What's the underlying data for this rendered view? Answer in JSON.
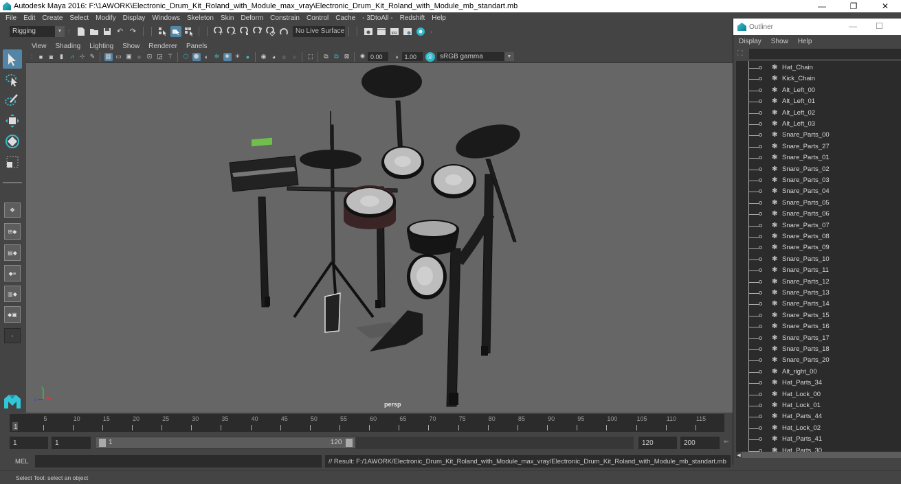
{
  "window": {
    "title": "Autodesk Maya 2016: F:\\1AWORK\\Electronic_Drum_Kit_Roland_with_Module_max_vray\\Electronic_Drum_Kit_Roland_with_Module_mb_standart.mb",
    "minimize": "—",
    "restore": "❐",
    "close": "✕"
  },
  "menubar": [
    "File",
    "Edit",
    "Create",
    "Select",
    "Modify",
    "Display",
    "Windows",
    "Skeleton",
    "Skin",
    "Deform",
    "Constrain",
    "Control",
    "Cache",
    "- 3DtoAll -",
    "Redshift",
    "Help"
  ],
  "statusline": {
    "menuset": "Rigging",
    "live_surface": "No Live Surface",
    "icons": [
      "new-scene-icon",
      "open-scene-icon",
      "save-scene-icon",
      "undo-icon",
      "redo-icon",
      "select-hierarchy-icon",
      "select-object-icon",
      "select-component-icon",
      "snap-grid-icon",
      "snap-curve-icon",
      "snap-point-icon",
      "snap-view-plane-icon",
      "snap-live-icon",
      "make-live-icon",
      "render-view-icon",
      "render-current-icon",
      "ipr-render-icon",
      "render-settings-icon",
      "hypershade-icon"
    ]
  },
  "panel": {
    "menus": [
      "View",
      "Shading",
      "Lighting",
      "Show",
      "Renderer",
      "Panels"
    ],
    "exposure": "0.00",
    "gamma": "1.00",
    "color_space": "sRGB gamma",
    "camera_label": "persp"
  },
  "timeline": {
    "current_frame": "1",
    "ticks": [
      5,
      10,
      15,
      20,
      25,
      30,
      35,
      40,
      45,
      50,
      55,
      60,
      65,
      70,
      75,
      80,
      85,
      90,
      95,
      100,
      105,
      110,
      115
    ],
    "range_min": 1,
    "range_max": 200
  },
  "range": {
    "start_time": "1",
    "playback_start": "1",
    "slider_start": "1",
    "slider_end": "120",
    "playback_end": "120",
    "end_time": "200"
  },
  "command": {
    "language": "MEL",
    "input": "",
    "result": "// Result: F:/1AWORK/Electronic_Drum_Kit_Roland_with_Module_max_vray/Electronic_Drum_Kit_Roland_with_Module_mb_standart.mb"
  },
  "help_line": "Select Tool: select an object",
  "outliner": {
    "title": "Outliner",
    "menus": [
      "Display",
      "Show",
      "Help"
    ],
    "filter": "",
    "items": [
      "Hat_Chain",
      "Kick_Chain",
      "Alt_Left_00",
      "Alt_Left_01",
      "Alt_Left_02",
      "Alt_Left_03",
      "Snare_Parts_00",
      "Snare_Parts_27",
      "Snare_Parts_01",
      "Snare_Parts_02",
      "Snare_Parts_03",
      "Snare_Parts_04",
      "Snare_Parts_05",
      "Snare_Parts_06",
      "Snare_Parts_07",
      "Snare_Parts_08",
      "Snare_Parts_09",
      "Snare_Parts_10",
      "Snare_Parts_11",
      "Snare_Parts_12",
      "Snare_Parts_13",
      "Snare_Parts_14",
      "Snare_Parts_15",
      "Snare_Parts_16",
      "Snare_Parts_17",
      "Snare_Parts_18",
      "Snare_Parts_20",
      "Alt_right_00",
      "Hat_Parts_34",
      "Hat_Lock_00",
      "Hat_Lock_01",
      "Hat_Parts_44",
      "Hat_Lock_02",
      "Hat_Parts_41",
      "Hat_Parts_30"
    ]
  },
  "colors": {
    "accent": "#5285a6",
    "ui_bg": "#444444",
    "field_bg": "#2b2b2b",
    "viewport_bg": "#666666",
    "maya_teal": "#2fb8c8"
  }
}
